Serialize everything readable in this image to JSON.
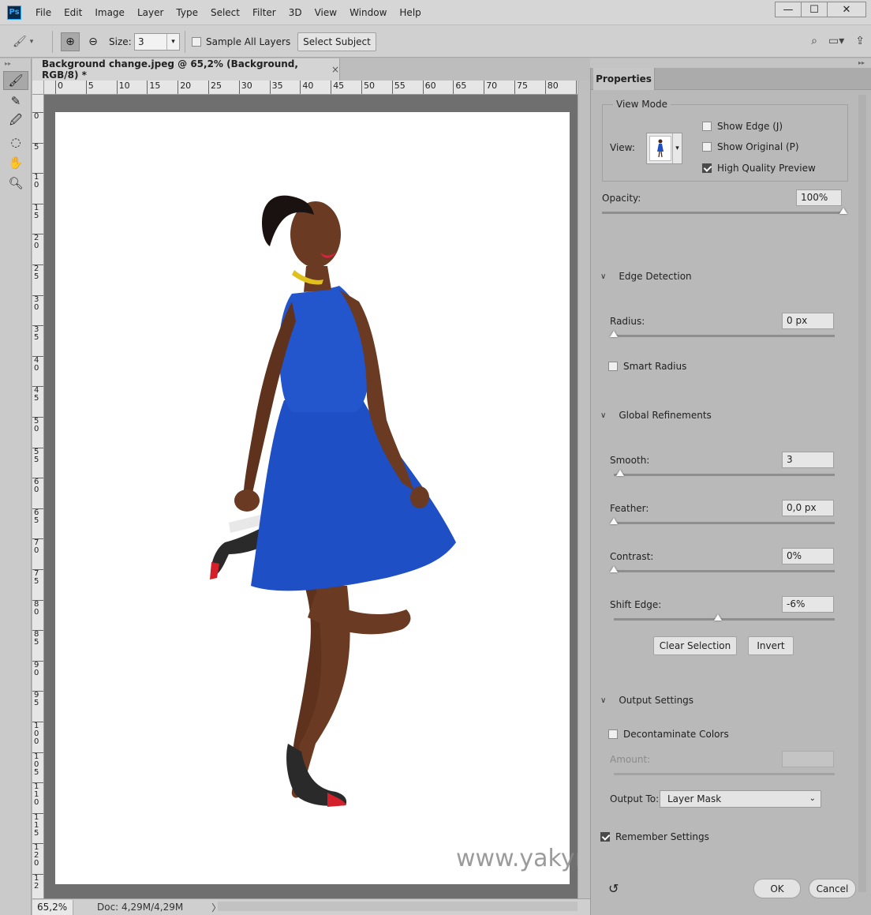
{
  "app": {
    "logo": "Ps"
  },
  "menu": [
    "File",
    "Edit",
    "Image",
    "Layer",
    "Type",
    "Select",
    "Filter",
    "3D",
    "View",
    "Window",
    "Help"
  ],
  "window_controls": {
    "minimize": "—",
    "maximize": "☐",
    "close": "✕"
  },
  "options_bar": {
    "size_label": "Size:",
    "size_value": "3",
    "sample_all_layers": "Sample All Layers",
    "sample_all_checked": false,
    "select_subject": "Select Subject"
  },
  "document": {
    "tab_title": "Background change.jpeg @ 65,2% (Background, RGB/8) *",
    "tab_close": "×",
    "ruler_h": [
      "0",
      "5",
      "10",
      "15",
      "20",
      "25",
      "30",
      "35",
      "40",
      "45",
      "50",
      "55",
      "60",
      "65",
      "70",
      "75",
      "80",
      "8"
    ],
    "ruler_v": [
      "0",
      "5",
      "10",
      "15",
      "20",
      "25",
      "30",
      "35",
      "40",
      "45",
      "50",
      "55",
      "60",
      "65",
      "70",
      "75",
      "80",
      "85",
      "90",
      "95",
      "100",
      "105",
      "110",
      "115",
      "120",
      "12"
    ],
    "watermark": "www.yakymchuk.net"
  },
  "status": {
    "zoom": "65,2%",
    "doc_info": "Doc: 4,29M/4,29M",
    "arrow": "〉"
  },
  "properties": {
    "tab": "Properties",
    "view_mode": {
      "title": "View Mode",
      "view_label": "View:",
      "show_edge": "Show Edge (J)",
      "show_edge_checked": false,
      "show_original": "Show Original (P)",
      "show_original_checked": false,
      "high_quality": "High Quality Preview",
      "high_quality_checked": true
    },
    "opacity": {
      "label": "Opacity:",
      "value": "100%",
      "level": 1.0
    },
    "edge_detection": {
      "title": "Edge Detection",
      "radius_label": "Radius:",
      "radius_value": "0 px",
      "radius_level": 0.0,
      "smart_radius": "Smart Radius",
      "smart_radius_checked": false
    },
    "global_refinements": {
      "title": "Global Refinements",
      "smooth_label": "Smooth:",
      "smooth_value": "3",
      "smooth_level": 0.03,
      "feather_label": "Feather:",
      "feather_value": "0,0 px",
      "feather_level": 0.0,
      "contrast_label": "Contrast:",
      "contrast_value": "0%",
      "contrast_level": 0.0,
      "shift_label": "Shift Edge:",
      "shift_value": "-6%",
      "shift_level": 0.47,
      "clear_selection": "Clear Selection",
      "invert": "Invert"
    },
    "output_settings": {
      "title": "Output Settings",
      "decontaminate": "Decontaminate Colors",
      "decontaminate_checked": false,
      "amount_label": "Amount:",
      "output_to_label": "Output To:",
      "output_to_value": "Layer Mask"
    },
    "remember_settings": "Remember Settings",
    "remember_checked": true,
    "ok": "OK",
    "cancel": "Cancel"
  },
  "colors": {
    "dress": "#1f4fc4",
    "skin": "#6b3a22",
    "panel": "#b9b9b9",
    "pasteboard": "#6f6f6f"
  }
}
